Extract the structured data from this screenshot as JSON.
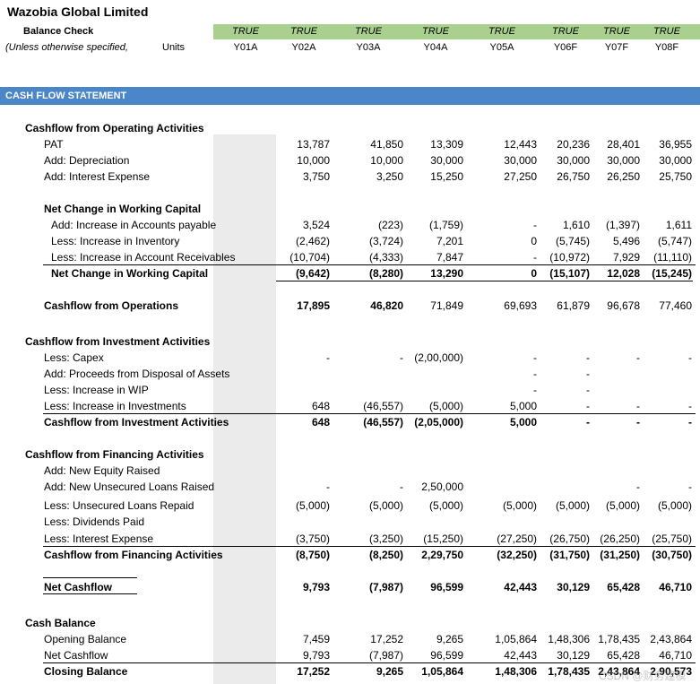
{
  "header": {
    "title": "Wazobia Global Limited",
    "balance_check": "Balance Check",
    "subtitle": "(Unless otherwise specified,",
    "units": "Units",
    "checks": [
      "TRUE",
      "TRUE",
      "TRUE",
      "TRUE",
      "TRUE",
      "TRUE",
      "TRUE",
      "TRUE"
    ],
    "years": [
      "Y01A",
      "Y02A",
      "Y03A",
      "Y04A",
      "Y05A",
      "Y06F",
      "Y07F",
      "Y08F"
    ]
  },
  "section_title": "CASH FLOW STATEMENT",
  "rows": [
    {
      "label": "Cashflow from Operating Activities",
      "indent": 0,
      "bold": true,
      "values": []
    },
    {
      "label": "PAT",
      "indent": 1,
      "bold": false,
      "values": [
        "13,787",
        "41,850",
        "13,309",
        "12,443",
        "20,236",
        "28,401",
        "36,955"
      ]
    },
    {
      "label": "Add: Depreciation",
      "indent": 1,
      "bold": false,
      "values": [
        "10,000",
        "10,000",
        "30,000",
        "30,000",
        "30,000",
        "30,000",
        "30,000"
      ]
    },
    {
      "label": "Add: Interest Expense",
      "indent": 1,
      "bold": false,
      "values": [
        "3,750",
        "3,250",
        "15,250",
        "27,250",
        "26,750",
        "26,250",
        "25,750"
      ]
    },
    {
      "label": "Net Change in Working Capital",
      "indent": 1,
      "bold": true,
      "values": []
    },
    {
      "label": "Add: Increase in Accounts payable",
      "indent": 2,
      "bold": false,
      "values": [
        "3,524",
        "(223)",
        "(1,759)",
        "-",
        "1,610",
        "(1,397)",
        "1,611"
      ]
    },
    {
      "label": "Less: Increase in Inventory",
      "indent": 2,
      "bold": false,
      "values": [
        "(2,462)",
        "(3,724)",
        "7,201",
        "0",
        "(5,745)",
        "5,496",
        "(5,747)"
      ]
    },
    {
      "label": "Less: Increase in Account Receivables",
      "indent": 2,
      "bold": false,
      "values": [
        "(10,704)",
        "(4,333)",
        "7,847",
        "-",
        "(10,972)",
        "7,929",
        "(11,110)"
      ]
    },
    {
      "label": "Net Change in Working Capital",
      "indent": 2,
      "bold": true,
      "values": [
        "(9,642)",
        "(8,280)",
        "13,290",
        "0",
        "(15,107)",
        "12,028",
        "(15,245)"
      ]
    },
    {
      "label": "Cashflow from Operations",
      "indent": 1,
      "bold": true,
      "values": [
        "17,895",
        "46,820",
        "71,849",
        "69,693",
        "61,879",
        "96,678",
        "77,460"
      ],
      "boldvals": [
        true,
        true,
        false,
        false,
        false,
        false,
        false
      ]
    },
    {
      "label": "Cashflow from Investment Activities",
      "indent": 0,
      "bold": true,
      "values": []
    },
    {
      "label": "Less: Capex",
      "indent": 1,
      "bold": false,
      "values": [
        "-",
        "-",
        "(2,00,000)",
        "-",
        "-",
        "-",
        "-"
      ]
    },
    {
      "label": "Add: Proceeds from Disposal of Assets",
      "indent": 1,
      "bold": false,
      "values": [
        "",
        "",
        "",
        "-",
        "-",
        "",
        ""
      ]
    },
    {
      "label": "Less: Increase in WIP",
      "indent": 1,
      "bold": false,
      "values": [
        "",
        "",
        "",
        "-",
        "-",
        "",
        ""
      ]
    },
    {
      "label": "Less: Increase in Investments",
      "indent": 1,
      "bold": false,
      "values": [
        "648",
        "(46,557)",
        "(5,000)",
        "5,000",
        "-",
        "-",
        "-"
      ]
    },
    {
      "label": "Cashflow from Investment Activities",
      "indent": 1,
      "bold": true,
      "values": [
        "648",
        "(46,557)",
        "(2,05,000)",
        "5,000",
        "-",
        "-",
        "-"
      ]
    },
    {
      "label": "Cashflow from Financing Activities",
      "indent": 0,
      "bold": true,
      "values": []
    },
    {
      "label": "Add: New Equity Raised",
      "indent": 1,
      "bold": false,
      "values": []
    },
    {
      "label": "Add: New Unsecured Loans Raised",
      "indent": 1,
      "bold": false,
      "values": [
        "-",
        "-",
        "2,50,000",
        "",
        "",
        "-",
        "-"
      ]
    },
    {
      "label": "Less: Unsecured Loans Repaid",
      "indent": 1,
      "bold": false,
      "values": [
        "(5,000)",
        "(5,000)",
        "(5,000)",
        "(5,000)",
        "(5,000)",
        "(5,000)",
        "(5,000)"
      ]
    },
    {
      "label": "Less: Dividends Paid",
      "indent": 1,
      "bold": false,
      "values": []
    },
    {
      "label": "Less: Interest Expense",
      "indent": 1,
      "bold": false,
      "values": [
        "(3,750)",
        "(3,250)",
        "(15,250)",
        "(27,250)",
        "(26,750)",
        "(26,250)",
        "(25,750)"
      ]
    },
    {
      "label": "Cashflow from Financing Activities",
      "indent": 1,
      "bold": true,
      "values": [
        "(8,750)",
        "(8,250)",
        "2,29,750",
        "(32,250)",
        "(31,750)",
        "(31,250)",
        "(30,750)"
      ]
    },
    {
      "label": "Net Cashflow",
      "indent": 1,
      "bold": true,
      "values": [
        "9,793",
        "(7,987)",
        "96,599",
        "42,443",
        "30,129",
        "65,428",
        "46,710"
      ]
    },
    {
      "label": "Cash Balance",
      "indent": 0,
      "bold": true,
      "values": []
    },
    {
      "label": "Opening Balance",
      "indent": 1,
      "bold": false,
      "values": [
        "7,459",
        "17,252",
        "9,265",
        "1,05,864",
        "1,48,306",
        "1,78,435",
        "2,43,864"
      ]
    },
    {
      "label": "Net Cashflow",
      "indent": 1,
      "bold": false,
      "values": [
        "9,793",
        "(7,987)",
        "96,599",
        "42,443",
        "30,129",
        "65,428",
        "46,710"
      ]
    },
    {
      "label": "Closing Balance",
      "indent": 1,
      "bold": true,
      "values": [
        "17,252",
        "9,265",
        "1,05,864",
        "1,48,306",
        "1,78,435",
        "2,43,864",
        "2,90,573"
      ]
    }
  ],
  "watermark": "CSDN @财务建模"
}
